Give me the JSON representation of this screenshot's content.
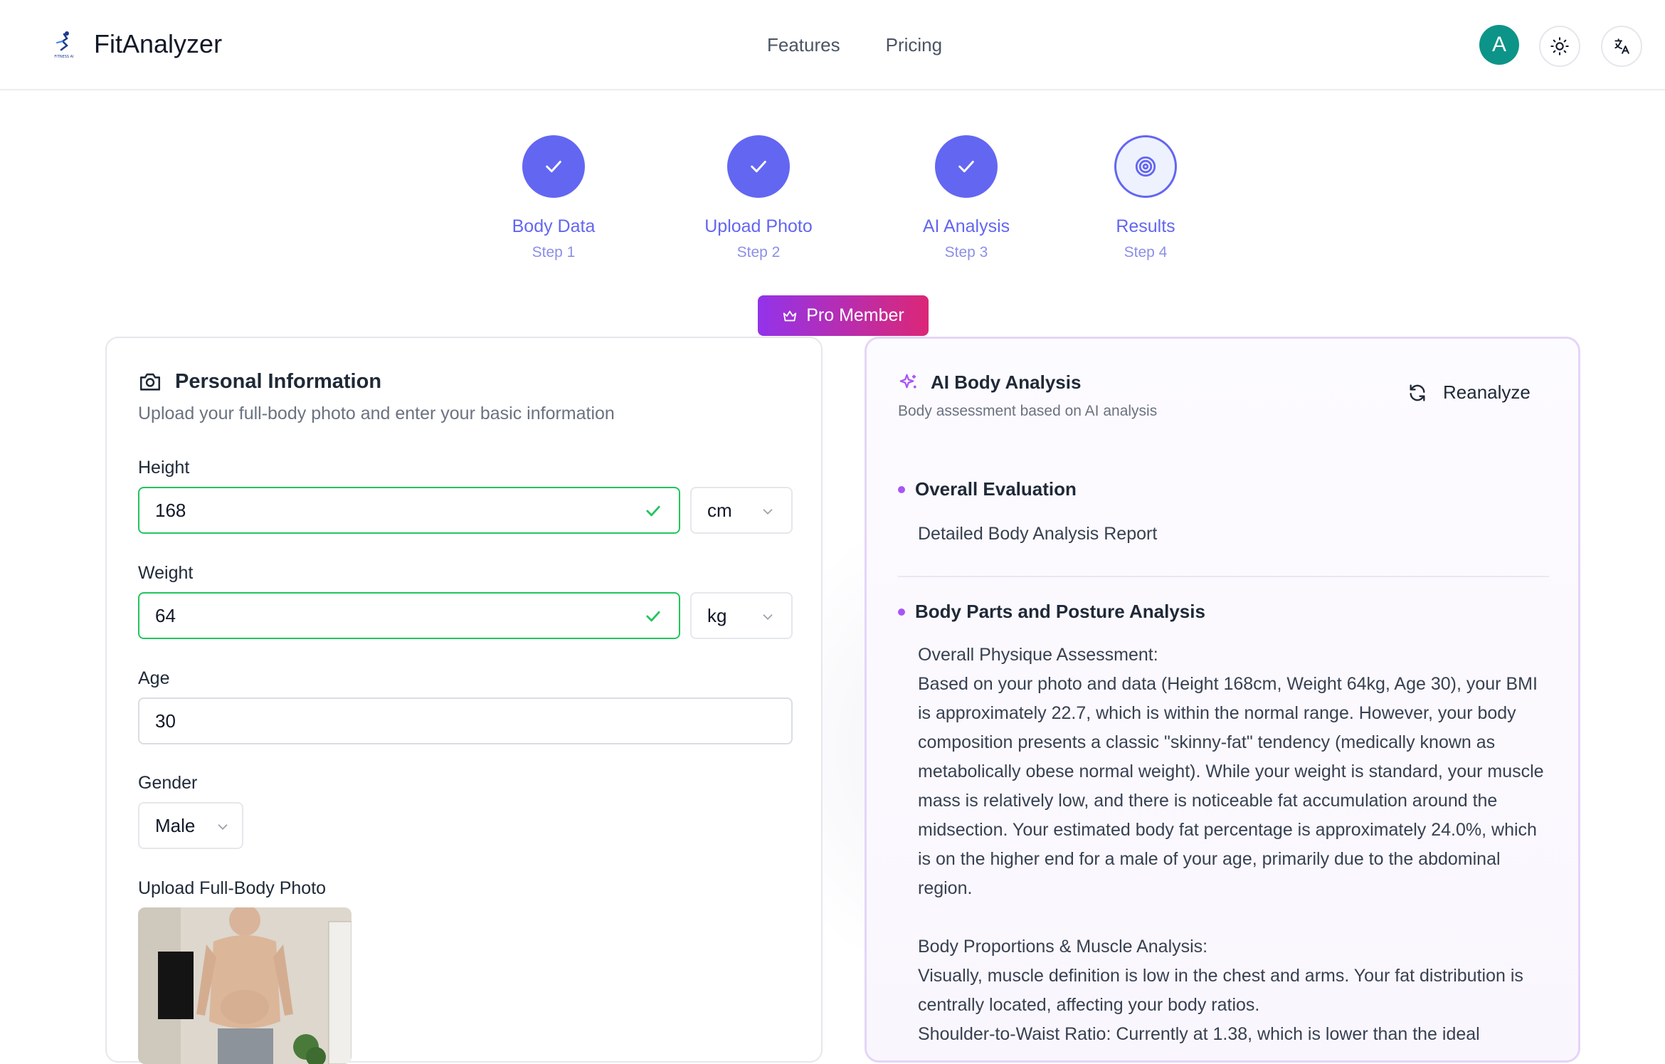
{
  "nav": {
    "brand": "FitAnalyzer",
    "logo_caption": "FITNESS AI",
    "links": [
      "Features",
      "Pricing"
    ],
    "avatar_initial": "A"
  },
  "steps": [
    {
      "label": "Body Data",
      "sub": "Step 1",
      "state": "done"
    },
    {
      "label": "Upload Photo",
      "sub": "Step 2",
      "state": "done"
    },
    {
      "label": "AI Analysis",
      "sub": "Step 3",
      "state": "done"
    },
    {
      "label": "Results",
      "sub": "Step 4",
      "state": "current"
    }
  ],
  "badge": {
    "label": "Pro Member"
  },
  "personal": {
    "title": "Personal Information",
    "description": "Upload your full-body photo and enter your basic information",
    "height_label": "Height",
    "height_value": "168",
    "height_unit": "cm",
    "weight_label": "Weight",
    "weight_value": "64",
    "weight_unit": "kg",
    "age_label": "Age",
    "age_value": "30",
    "gender_label": "Gender",
    "gender_value": "Male",
    "photo_label": "Upload Full-Body Photo"
  },
  "analysis": {
    "title": "AI Body Analysis",
    "subtitle": "Body assessment based on AI analysis",
    "reanalyze_label": "Reanalyze",
    "overall_title": "Overall Evaluation",
    "overall_body": "Detailed Body Analysis Report",
    "posture_title": "Body Parts and Posture Analysis",
    "para1_heading": "Overall Physique Assessment:",
    "para1_text": "Based on your photo and data (Height 168cm, Weight 64kg, Age 30), your BMI is approximately 22.7, which is within the normal range. However, your body composition presents a classic \"skinny-fat\" tendency (medically known as metabolically obese normal weight). While your weight is standard, your muscle mass is relatively low, and there is noticeable fat accumulation around the midsection. Your estimated body fat percentage is approximately 24.0%, which is on the higher end for a male of your age, primarily due to the abdominal region.",
    "para2_heading": "Body Proportions & Muscle Analysis:",
    "para2_text": "Visually, muscle definition is low in the chest and arms. Your fat distribution is centrally located, affecting your body ratios.",
    "para2_text2": "Shoulder-to-Waist Ratio: Currently at 1.38, which is lower than the ideal"
  },
  "colors": {
    "accent": "#6366f1",
    "success": "#22c55e",
    "avatar": "#0d9488",
    "pro_gradient_start": "#9333ea",
    "pro_gradient_end": "#db2777"
  }
}
